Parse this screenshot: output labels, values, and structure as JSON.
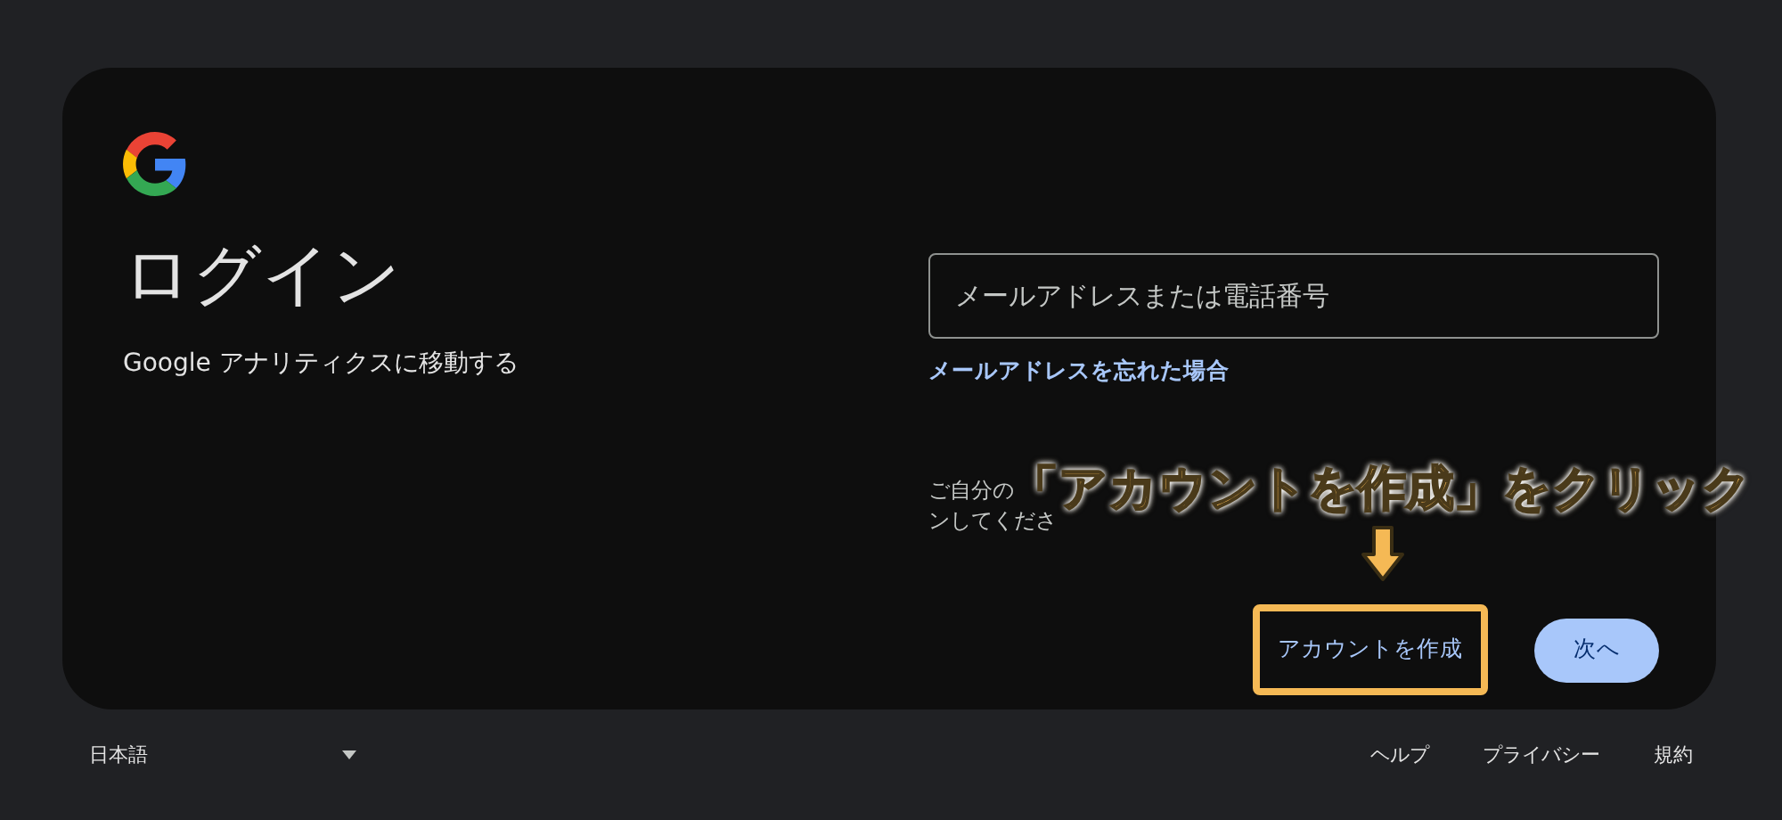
{
  "card": {
    "title": "ログイン",
    "subtitle": "Google アナリティクスに移動する",
    "email_field": {
      "placeholder": "メールアドレスまたは電話番号"
    },
    "forgot_link": "メールアドレスを忘れた場合",
    "guest_note": {
      "line_1_start": "ご自分の",
      "line_2_start": "ンしてくださ"
    },
    "create_account_button": "アカウントを作成",
    "next_button": "次へ"
  },
  "annotation": {
    "text": "「アカウントを作成」をクリック"
  },
  "footer": {
    "language": "日本語",
    "links": [
      "ヘルプ",
      "プライバシー",
      "規約"
    ]
  }
}
